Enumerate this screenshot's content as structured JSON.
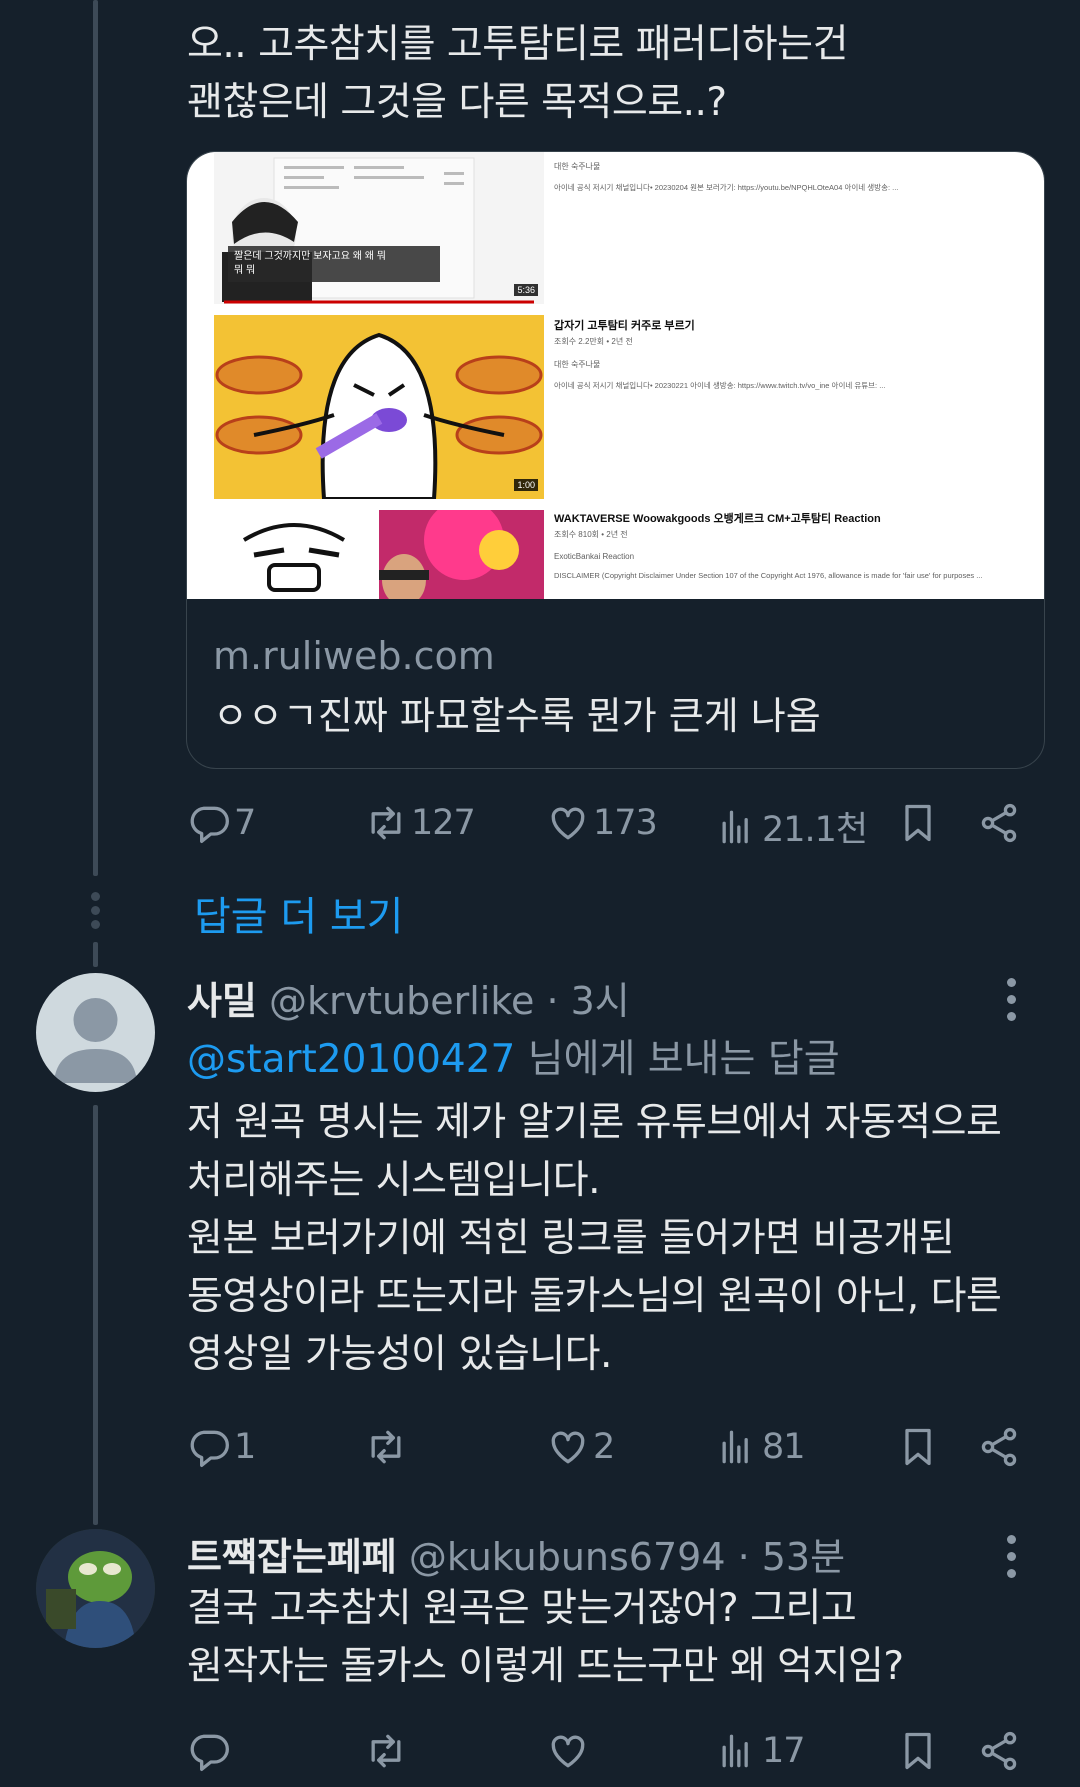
{
  "tweet1": {
    "text": "오.. 고추참치를 고투탐티로 패러디하는건\n괜찮은데 그것을 다른 목적으로..?",
    "card": {
      "domain": "m.ruliweb.com",
      "title": "ㅇㅇㄱ진짜 파묘할수록 뭔가 큰게 나옴",
      "videos": [
        {
          "caption": "짤은데 그것까지만 보자고요 왜 왜 뭐\n뭐 뭐",
          "duration": "5:36",
          "channel": "대한 숙주나물",
          "desc": "아이네 공식 저시기 채널입니다• 20230204 원본 보러가기: https://youtu.be/NPQHLOteA04 아이네 생방송: ..."
        },
        {
          "title": "갑자기 고투탐티 커주로 부르기",
          "meta": "조회수 2.2만회 • 2년 전",
          "channel": "대한 숙주나물",
          "desc": "아이네 공식 저시기 채널입니다• 20230221 아이네 생방송: https://www.twitch.tv/vo_ine 아이네 유튜브: ...",
          "duration": "1:00"
        },
        {
          "title": "WAKTAVERSE Woowakgoods 오뱅게르크 CM+고투탐티 Reaction",
          "meta": "조회수 810회 • 2년 전",
          "channel": "ExoticBankai Reaction",
          "desc": "DISCLAIMER (Copyright Disclaimer Under Section 107 of the Copyright Act 1976, allowance is made for 'fair use' for purposes ..."
        }
      ]
    },
    "actions": {
      "replies": "7",
      "retweets": "127",
      "likes": "173",
      "views": "21.1천"
    }
  },
  "show_more": "답글 더 보기",
  "tweet2": {
    "name": "사밀",
    "handle": "@krvtuberlike · 3시",
    "reply_to_mention": "@start20100427",
    "reply_to_suffix": " 님에게 보내는 답글",
    "text": "저 원곡 명시는 제가 알기론 유튜브에서 자동적으로\n처리해주는 시스템입니다.\n원본 보러가기에 적힌 링크를 들어가면 비공개된\n동영상이라 뜨는지라 돌카스님의 원곡이 아닌, 다른\n영상일 가능성이 있습니다.",
    "actions": {
      "replies": "1",
      "retweets": "",
      "likes": "2",
      "views": "81"
    }
  },
  "tweet3": {
    "name": "트쨱잡는페페",
    "handle": "@kukubuns6794 · 53분",
    "text": "결국 고추참치 원곡은 맞는거잖어? 그리고\n원작자는 돌카스 이렇게 뜨는구만 왜 억지임?",
    "actions": {
      "replies": "",
      "retweets": "",
      "likes": "",
      "views": "17"
    }
  },
  "colors": {
    "background": "#15202b",
    "link": "#1d9bf0",
    "muted": "#8b98a5"
  }
}
